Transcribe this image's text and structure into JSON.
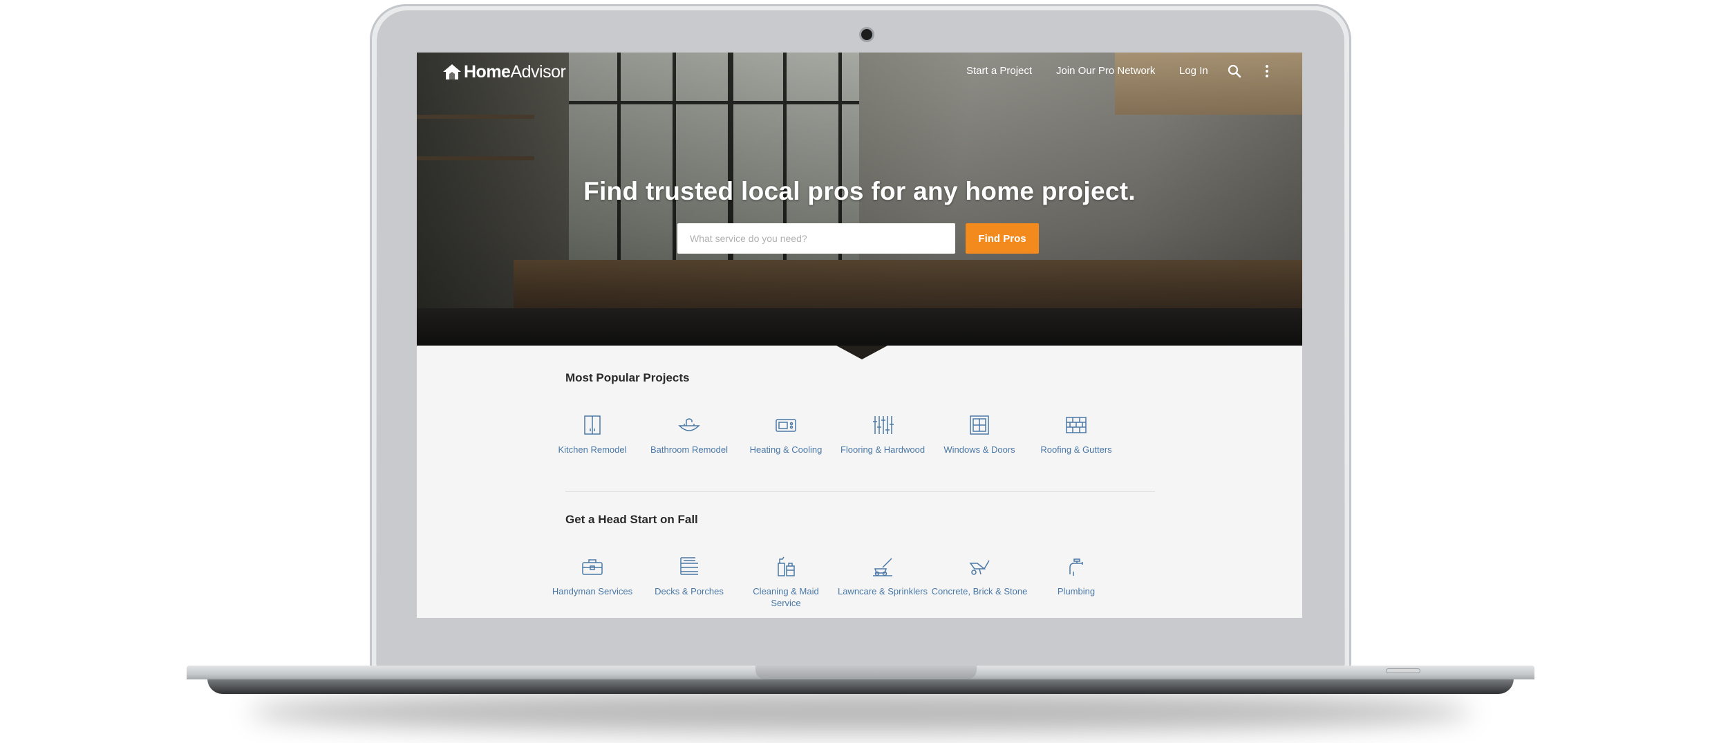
{
  "nav": {
    "logo": {
      "brand_bold": "Home",
      "brand_light": "Advisor"
    },
    "links": [
      "Start a Project",
      "Join Our Pro Network",
      "Log In"
    ],
    "search_icon": "search-icon",
    "more_icon": "vertical-dots-icon"
  },
  "hero": {
    "headline": "Find trusted local pros for any home project.",
    "search_placeholder": "What service do you need?",
    "button_label": "Find Pros"
  },
  "popular": {
    "title": "Most Popular Projects",
    "items": [
      {
        "label": "Kitchen Remodel",
        "icon": "cabinet-icon"
      },
      {
        "label": "Bathroom Remodel",
        "icon": "sink-icon"
      },
      {
        "label": "Heating & Cooling",
        "icon": "furnace-icon"
      },
      {
        "label": "Flooring & Hardwood",
        "icon": "flooring-icon"
      },
      {
        "label": "Windows & Doors",
        "icon": "window-icon"
      },
      {
        "label": "Roofing & Gutters",
        "icon": "brick-icon"
      }
    ]
  },
  "fall": {
    "title": "Get a Head Start on Fall",
    "items": [
      {
        "label": "Handyman Services",
        "icon": "toolbox-icon"
      },
      {
        "label": "Decks & Porches",
        "icon": "deck-icon"
      },
      {
        "label": "Cleaning & Maid Service",
        "icon": "cleaning-bottles-icon"
      },
      {
        "label": "Lawncare & Sprinklers",
        "icon": "lawnmower-icon"
      },
      {
        "label": "Concrete, Brick & Stone",
        "icon": "wheelbarrow-icon"
      },
      {
        "label": "Plumbing",
        "icon": "faucet-icon"
      }
    ]
  },
  "colors": {
    "accent": "#f28a1e",
    "link": "#4a78a6"
  }
}
